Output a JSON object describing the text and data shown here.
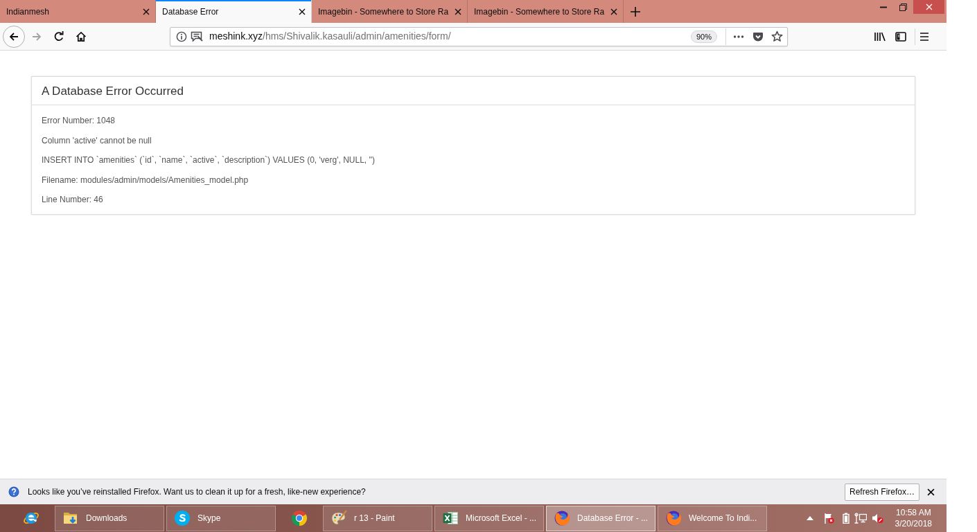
{
  "tabs": [
    {
      "title": "Indianmesh",
      "selected": false
    },
    {
      "title": "Database Error",
      "selected": true
    },
    {
      "title": "Imagebin - Somewhere to Store Ra",
      "selected": false
    },
    {
      "title": "Imagebin - Somewhere to Store Ra",
      "selected": false
    }
  ],
  "address_bar": {
    "host": "meshink.xyz",
    "path": "/hms/Shivalik.kasauli/admin/amenities/form/",
    "zoom": "90%"
  },
  "error": {
    "title": "A Database Error Occurred",
    "lines": [
      "Error Number: 1048",
      "Column 'active' cannot be null",
      "INSERT INTO `amenities` (`id`, `name`, `active`, `description`) VALUES (0, 'verg', NULL, '')",
      "Filename: modules/admin/models/Amenities_model.php",
      "Line Number: 46"
    ]
  },
  "notification": {
    "message": "Looks like you’ve reinstalled Firefox. Want us to clean it up for a fresh, like-new experience?",
    "button": "Refresh Firefox…"
  },
  "taskbar": {
    "items": [
      {
        "kind": "ie",
        "selected": false
      },
      {
        "kind": "folder",
        "label": "Downloads",
        "selected": false
      },
      {
        "kind": "skype",
        "label": "Skype",
        "selected": false
      },
      {
        "kind": "chrome",
        "selected": false
      },
      {
        "kind": "paint",
        "label": "r 13 - Paint",
        "selected": false
      },
      {
        "kind": "excel",
        "label": "Microsoft Excel - ...",
        "selected": false
      },
      {
        "kind": "firefox",
        "label": "Database Error - ...",
        "selected": true
      },
      {
        "kind": "firefox",
        "label": "Welcome To Indi...",
        "selected": false
      }
    ],
    "clock": {
      "time": "10:58 AM",
      "date": "3/20/2018"
    }
  }
}
